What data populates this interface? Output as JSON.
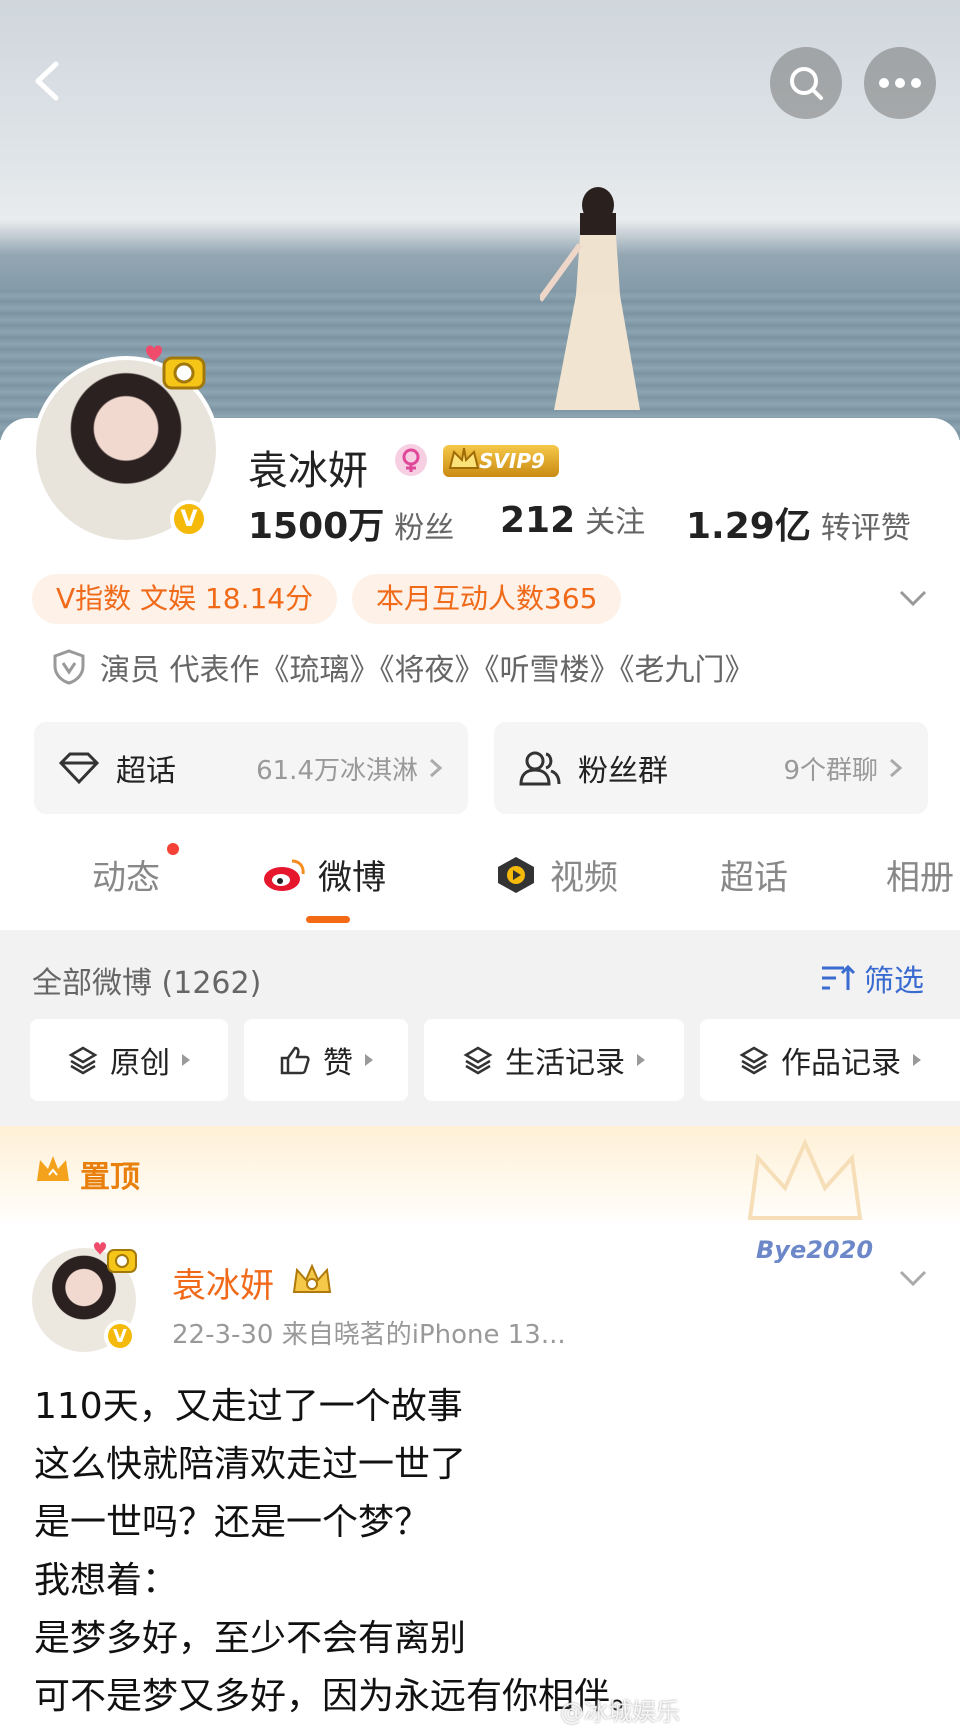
{
  "profile": {
    "name": "袁冰妍",
    "svip": "SVIP9",
    "stats": [
      {
        "value": "1500万",
        "label": "粉丝"
      },
      {
        "value": "212",
        "label": "关注"
      },
      {
        "value": "1.29亿",
        "label": "转评赞"
      }
    ],
    "pills": [
      "V指数 文娱 18.14分",
      "本月互动人数365"
    ],
    "intro": "演员 代表作《琉璃》《将夜》《听雪楼》《老九门》",
    "supertopic": {
      "label": "超话",
      "value": "61.4万冰淇淋"
    },
    "fangroup": {
      "label": "粉丝群",
      "value": "9个群聊"
    }
  },
  "tabs": [
    "动态",
    "微博",
    "视频",
    "超话",
    "相册"
  ],
  "feed": {
    "title": "全部微博 (1262)",
    "filter": "筛选",
    "chips": [
      "原创",
      "赞",
      "生活记录",
      "作品记录"
    ]
  },
  "post": {
    "pinned_label": "置顶",
    "author": "袁冰妍",
    "meta": "22-3-30   来自晓茗的iPhone 13...",
    "decor_text": "Bye2020",
    "lines": [
      "110天，又走过了一个故事",
      "这么快就陪清欢走过一世了",
      "是一世吗？还是一个梦？",
      "我想着：",
      "是梦多好，至少不会有离别",
      "可不是梦又多好，因为永远有你相伴。"
    ]
  },
  "watermark": "@冰城娱乐",
  "colors": {
    "accent": "#f06a19",
    "link": "#3a6bd1",
    "gold": "#f5b90a"
  }
}
